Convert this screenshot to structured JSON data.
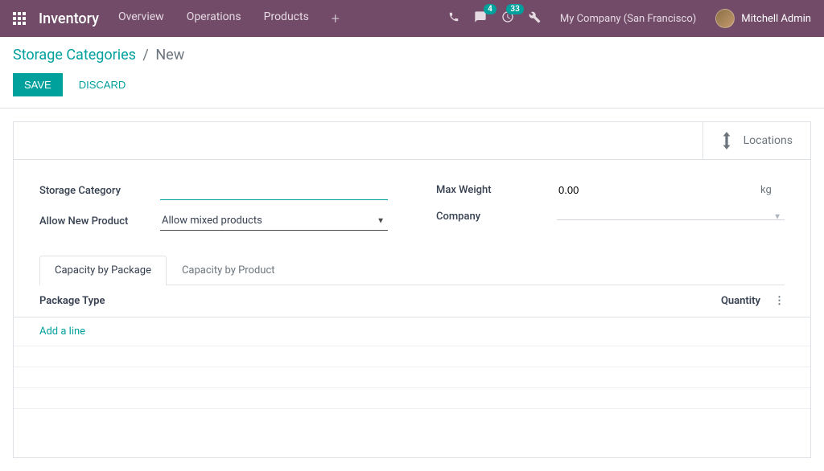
{
  "navbar": {
    "brand": "Inventory",
    "items": [
      "Overview",
      "Operations",
      "Products"
    ],
    "chat_badge": "4",
    "activity_badge": "33",
    "company": "My Company (San Francisco)",
    "user": "Mitchell Admin"
  },
  "breadcrumb": {
    "parent": "Storage Categories",
    "current": "New"
  },
  "buttons": {
    "save": "Save",
    "discard": "Discard"
  },
  "stat": {
    "locations": "Locations"
  },
  "form": {
    "labels": {
      "storage_category": "Storage Category",
      "allow_new_product": "Allow New Product",
      "max_weight": "Max Weight",
      "company": "Company"
    },
    "values": {
      "storage_category": "",
      "allow_new_product": "Allow mixed products",
      "max_weight": "0.00",
      "max_weight_unit": "kg",
      "company": ""
    }
  },
  "tabs": {
    "by_package": "Capacity by Package",
    "by_product": "Capacity by Product"
  },
  "list": {
    "col_package": "Package Type",
    "col_quantity": "Quantity",
    "add_line": "Add a line"
  }
}
